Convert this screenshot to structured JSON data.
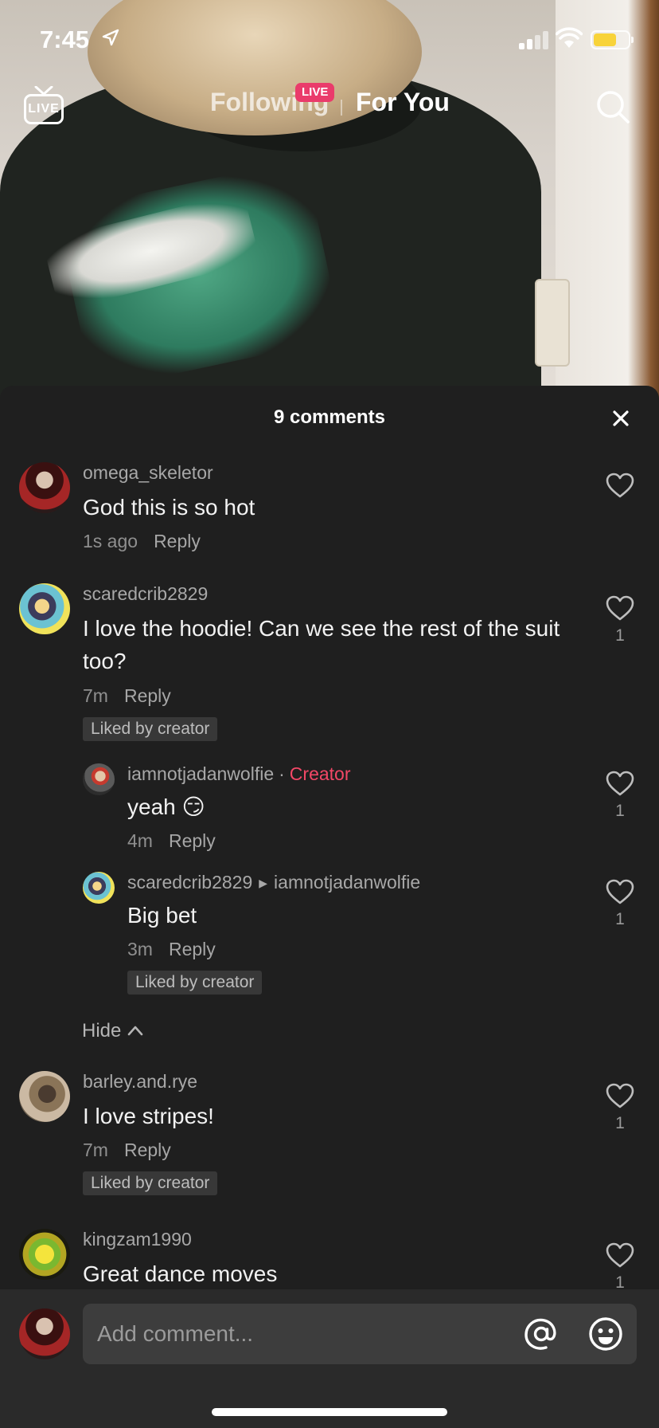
{
  "status_bar": {
    "time": "7:45",
    "battery_color": "#f8d33a"
  },
  "top_nav": {
    "live_icon_label": "LIVE",
    "tab_following": "Following",
    "live_badge": "LIVE",
    "tab_for_you": "For You"
  },
  "comments_panel": {
    "title": "9 comments",
    "comments": [
      {
        "username": "omega_skeletor",
        "text": "God this is so hot",
        "time": "1s ago",
        "reply": "Reply"
      },
      {
        "username": "scaredcrib2829",
        "text": "I love the hoodie! Can we see the rest of the suit too?",
        "time": "7m",
        "reply": "Reply",
        "likes": "1",
        "liked_by_creator": "Liked by creator"
      },
      {
        "username": "iamnotjadanwolfie",
        "separator": "·",
        "creator_tag": "Creator",
        "text": "yeah 😏",
        "time": "4m",
        "reply": "Reply",
        "likes": "1"
      },
      {
        "username": "scaredcrib2829",
        "reply_to": "iamnotjadanwolfie",
        "text": "Big bet",
        "time": "3m",
        "reply": "Reply",
        "likes": "1",
        "liked_by_creator": "Liked by creator"
      },
      {
        "username": "barley.and.rye",
        "text": "I love stripes!",
        "time": "7m",
        "reply": "Reply",
        "likes": "1",
        "liked_by_creator": "Liked by creator"
      },
      {
        "username": "kingzam1990",
        "text": "Great dance moves",
        "likes": "1"
      }
    ],
    "hide_label": "Hide"
  },
  "comment_input": {
    "placeholder": "Add comment..."
  },
  "icons": {
    "live": "tv-icon",
    "search": "search-icon",
    "close": "close-icon",
    "like": "heart-icon",
    "mention": "at-icon",
    "emoji": "emoji-icon"
  },
  "colors": {
    "creator_tag": "#f24766",
    "live_badge": "#ea3b6b",
    "sheet_bg": "#1f1f1f"
  }
}
